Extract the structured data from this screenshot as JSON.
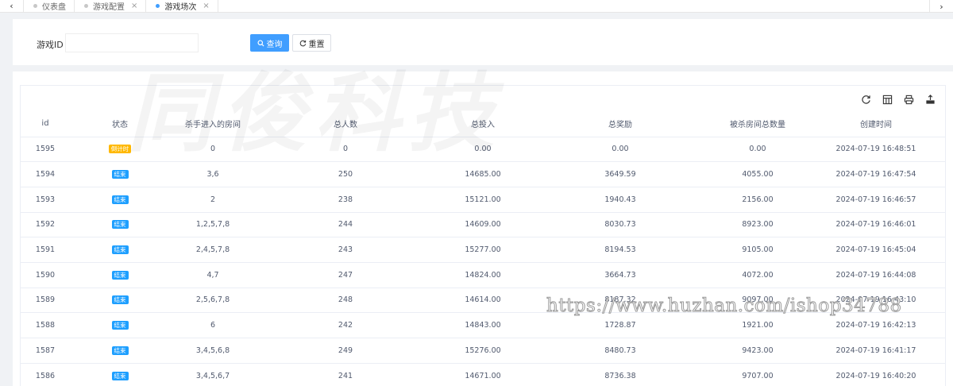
{
  "tabs": [
    {
      "label": "仪表盘",
      "active": false,
      "closable": false
    },
    {
      "label": "游戏配置",
      "active": false,
      "closable": true
    },
    {
      "label": "游戏场次",
      "active": true,
      "closable": true
    }
  ],
  "search": {
    "label": "游戏ID",
    "value": "",
    "placeholder": "",
    "query_label": "查询",
    "reset_label": "重置"
  },
  "table": {
    "columns": [
      "id",
      "状态",
      "杀手进入的房间",
      "总人数",
      "总投入",
      "总奖励",
      "被杀房间总数量",
      "创建时间"
    ],
    "rows": [
      {
        "id": "1595",
        "status": "倒计时",
        "status_color": "#ffb800",
        "rooms": "0",
        "players": "0",
        "invest": "0.00",
        "reward": "0.00",
        "killed": "0.00",
        "time": "2024-07-19 16:48:51"
      },
      {
        "id": "1594",
        "status": "结束",
        "status_color": "#1e9fff",
        "rooms": "3,6",
        "players": "250",
        "invest": "14685.00",
        "reward": "3649.59",
        "killed": "4055.00",
        "time": "2024-07-19 16:47:54"
      },
      {
        "id": "1593",
        "status": "结束",
        "status_color": "#1e9fff",
        "rooms": "2",
        "players": "238",
        "invest": "15121.00",
        "reward": "1940.43",
        "killed": "2156.00",
        "time": "2024-07-19 16:46:57"
      },
      {
        "id": "1592",
        "status": "结束",
        "status_color": "#1e9fff",
        "rooms": "1,2,5,7,8",
        "players": "244",
        "invest": "14609.00",
        "reward": "8030.73",
        "killed": "8923.00",
        "time": "2024-07-19 16:46:01"
      },
      {
        "id": "1591",
        "status": "结束",
        "status_color": "#1e9fff",
        "rooms": "2,4,5,7,8",
        "players": "243",
        "invest": "15277.00",
        "reward": "8194.53",
        "killed": "9105.00",
        "time": "2024-07-19 16:45:04"
      },
      {
        "id": "1590",
        "status": "结束",
        "status_color": "#1e9fff",
        "rooms": "4,7",
        "players": "247",
        "invest": "14824.00",
        "reward": "3664.73",
        "killed": "4072.00",
        "time": "2024-07-19 16:44:08"
      },
      {
        "id": "1589",
        "status": "结束",
        "status_color": "#1e9fff",
        "rooms": "2,5,6,7,8",
        "players": "248",
        "invest": "14614.00",
        "reward": "8187.32",
        "killed": "9097.00",
        "time": "2024-07-19 16:43:10"
      },
      {
        "id": "1588",
        "status": "结束",
        "status_color": "#1e9fff",
        "rooms": "6",
        "players": "242",
        "invest": "14843.00",
        "reward": "1728.87",
        "killed": "1921.00",
        "time": "2024-07-19 16:42:13"
      },
      {
        "id": "1587",
        "status": "结束",
        "status_color": "#1e9fff",
        "rooms": "3,4,5,6,8",
        "players": "249",
        "invest": "15276.00",
        "reward": "8480.73",
        "killed": "9423.00",
        "time": "2024-07-19 16:41:17"
      },
      {
        "id": "1586",
        "status": "结束",
        "status_color": "#1e9fff",
        "rooms": "3,4,5,6,7",
        "players": "241",
        "invest": "14671.00",
        "reward": "8736.38",
        "killed": "9707.00",
        "time": "2024-07-19 16:40:20"
      }
    ]
  },
  "toolbar": {
    "icons": [
      "refresh-icon",
      "columns-icon",
      "print-icon",
      "export-icon"
    ]
  },
  "watermark": {
    "brand": "同俊科技",
    "url": "https://www.huzhan.com/ishop34788"
  }
}
